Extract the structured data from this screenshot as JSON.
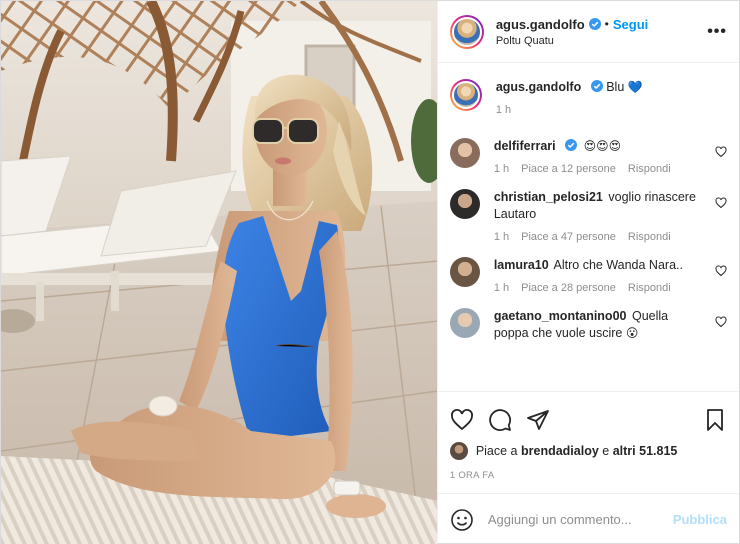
{
  "post": {
    "author": "agus.gandolfo",
    "follow_label": "Segui",
    "dot": "•",
    "location": "Poltu Quatu",
    "more_label": "•••",
    "photo_alt": "Post photo"
  },
  "caption": {
    "username": "agus.gandolfo",
    "text": "Blu",
    "emoji": "💙",
    "time": "1 h"
  },
  "comments": [
    {
      "username": "delfiferrari",
      "text": "",
      "emoji": "😍😍😍",
      "time": "1 h",
      "likes": "Piace a 12 persone",
      "reply": "Rispondi"
    },
    {
      "username": "christian_pelosi21",
      "text": "voglio rinascere Lautaro",
      "emoji": "",
      "time": "1 h",
      "likes": "Piace a 47 persone",
      "reply": "Rispondi"
    },
    {
      "username": "lamura10",
      "text": "Altro che Wanda Nara..",
      "emoji": "",
      "time": "1 h",
      "likes": "Piace a 28 persone",
      "reply": "Rispondi"
    },
    {
      "username": "gaetano_montanino00",
      "text": "Quella poppa che vuole uscire",
      "emoji": "😮",
      "time": "",
      "likes": "",
      "reply": ""
    }
  ],
  "likes": {
    "prefix": "Piace a",
    "first_user": "brendadialoy",
    "conj": "e",
    "others": "altri 51.815"
  },
  "timestamp": "1 ORA FA",
  "add_comment": {
    "placeholder": "Aggiungi un commento...",
    "publish_label": "Pubblica"
  },
  "icons": {
    "like": "heart-icon",
    "comment": "comment-icon",
    "share": "paper-plane-icon",
    "save": "bookmark-icon",
    "emoji": "smiley-icon",
    "verified": "verified-badge-icon"
  },
  "colors": {
    "accent": "#0095f6",
    "verified": "#3897f0",
    "muted": "#8e8e8e",
    "publish_disabled": "#b2dffc",
    "swimsuit": "#2b6fd0"
  }
}
